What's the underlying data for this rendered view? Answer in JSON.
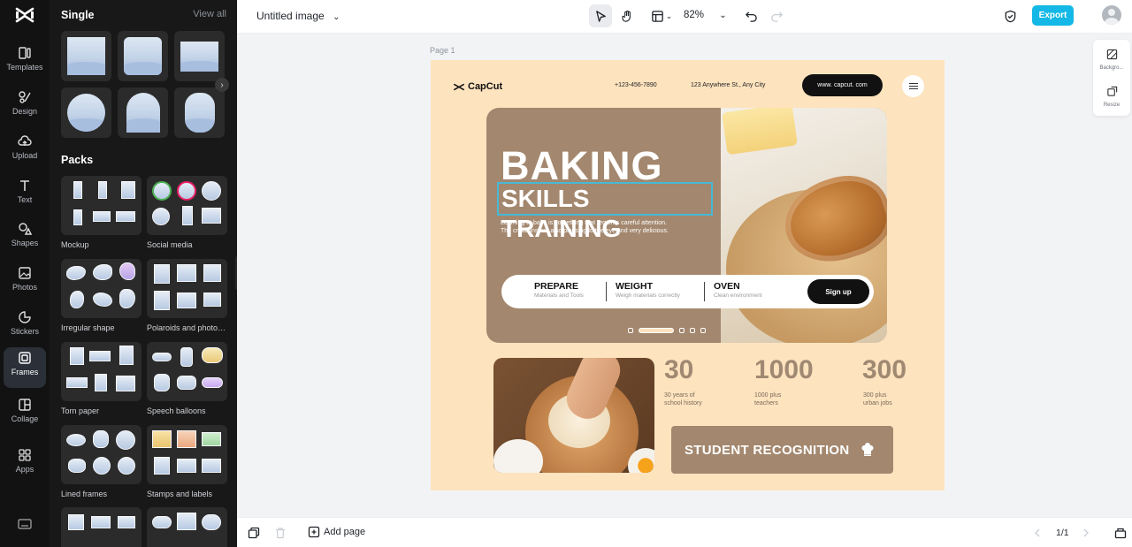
{
  "rail": {
    "items": [
      {
        "label": "Templates"
      },
      {
        "label": "Design"
      },
      {
        "label": "Upload"
      },
      {
        "label": "Text"
      },
      {
        "label": "Shapes"
      },
      {
        "label": "Photos"
      },
      {
        "label": "Stickers"
      },
      {
        "label": "Frames"
      },
      {
        "label": "Collage"
      },
      {
        "label": "Apps"
      }
    ],
    "active": "Frames"
  },
  "panel": {
    "single_title": "Single",
    "view_all": "View all",
    "packs_title": "Packs",
    "packs": [
      {
        "name": "Mockup"
      },
      {
        "name": "Social media"
      },
      {
        "name": "Irregular shape"
      },
      {
        "name": "Polaroids and photo f..."
      },
      {
        "name": "Torn paper"
      },
      {
        "name": "Speech balloons"
      },
      {
        "name": "Lined frames"
      },
      {
        "name": "Stamps and labels"
      }
    ]
  },
  "topbar": {
    "title": "Untitled image",
    "zoom": "82%",
    "export_label": "Export"
  },
  "canvas": {
    "page_label": "Page 1",
    "tools": [
      {
        "label": "Backgro..."
      },
      {
        "label": "Resize"
      }
    ]
  },
  "design": {
    "brand": "CapCut",
    "phone": "+123-456-7890",
    "address": "123 Anywhere St., Any City",
    "url": "www. capcut. com",
    "headline1": "BAKING",
    "headline2": "SKILLS TRAINING",
    "desc_line1": "Learning to bake is something that requires careful attention.",
    "desc_line2": "The creations are also pleasing to the eye and very delicious.",
    "features": [
      {
        "title": "PREPARE",
        "sub": "Materials and Tools"
      },
      {
        "title": "WEIGHT",
        "sub": "Weigh materials correctly"
      },
      {
        "title": "OVEN",
        "sub": "Clean environment"
      }
    ],
    "signup_label": "Sign up",
    "stats": [
      {
        "num": "30",
        "line1": "30 years of",
        "line2": "school history"
      },
      {
        "num": "1000",
        "line1": "1000 plus",
        "line2": "teachers"
      },
      {
        "num": "300",
        "line1": "300 plus",
        "line2": "urban jobs"
      }
    ],
    "recognition": "STUDENT RECOGNITION"
  },
  "bottombar": {
    "add_page": "Add page",
    "pager": "1/1"
  },
  "colors": {
    "accent": "#14b8e6",
    "page_bg": "#fde3be",
    "hero_brown": "#a3876e"
  }
}
